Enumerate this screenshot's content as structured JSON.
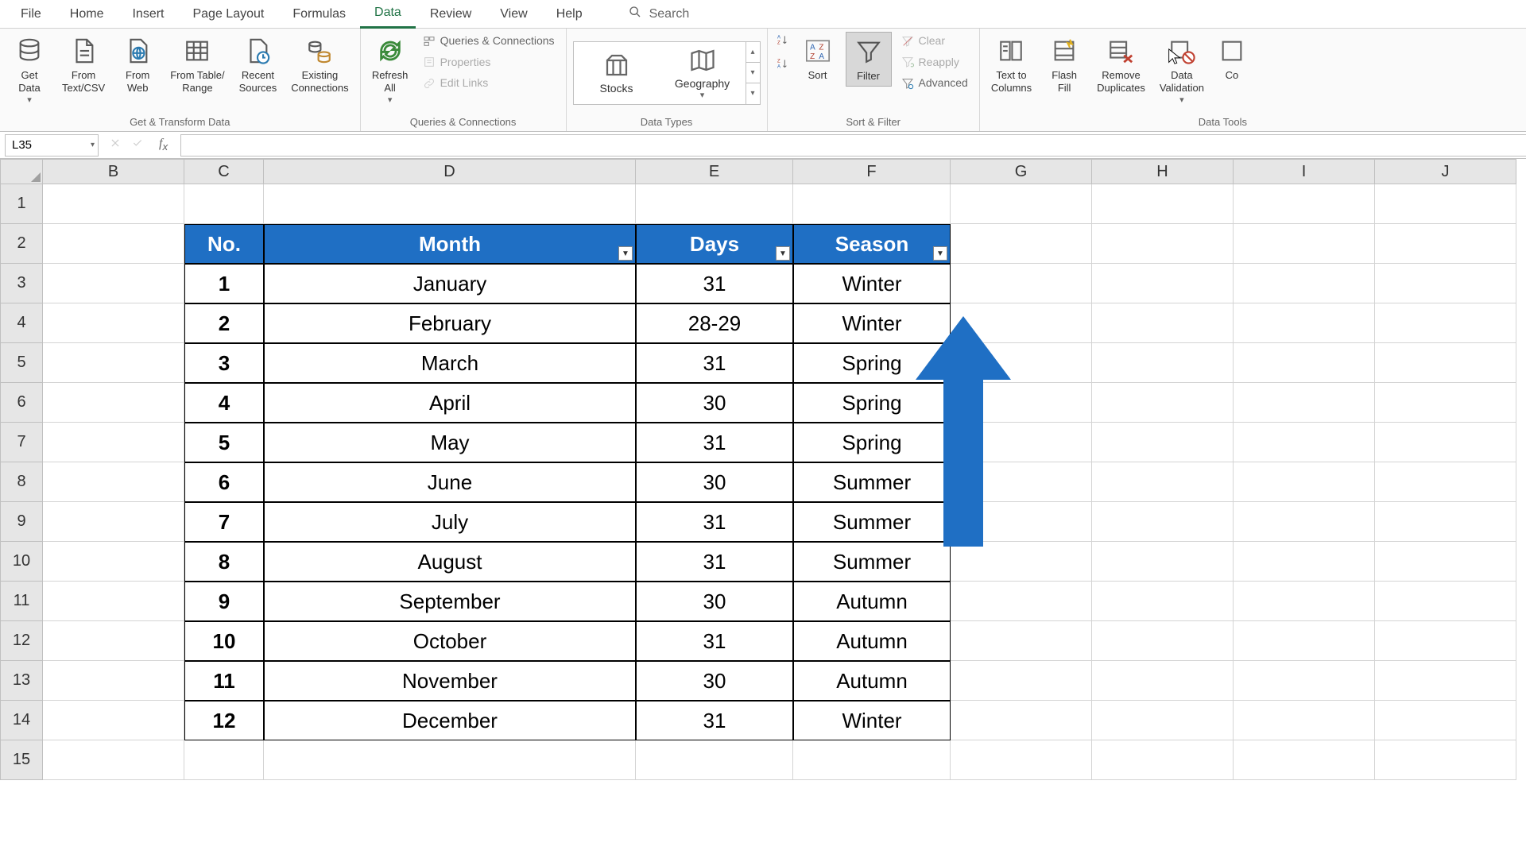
{
  "tabs": [
    "File",
    "Home",
    "Insert",
    "Page Layout",
    "Formulas",
    "Data",
    "Review",
    "View",
    "Help"
  ],
  "active_tab": "Data",
  "search_placeholder": "Search",
  "ribbon": {
    "group1": {
      "label": "Get & Transform Data",
      "btns": [
        "Get\nData",
        "From\nText/CSV",
        "From\nWeb",
        "From Table/\nRange",
        "Recent\nSources",
        "Existing\nConnections"
      ]
    },
    "group2": {
      "label": "Queries & Connections",
      "main": "Refresh\nAll",
      "items": [
        "Queries & Connections",
        "Properties",
        "Edit Links"
      ]
    },
    "group3": {
      "label": "Data Types",
      "items": [
        "Stocks",
        "Geography"
      ]
    },
    "group4": {
      "label": "Sort & Filter",
      "sort": "Sort",
      "filter": "Filter",
      "clear": "Clear",
      "reapply": "Reapply",
      "advanced": "Advanced"
    },
    "group5": {
      "label": "Data Tools",
      "btns": [
        "Text to\nColumns",
        "Flash\nFill",
        "Remove\nDuplicates",
        "Data\nValidation",
        "Co"
      ]
    }
  },
  "namebox": "L35",
  "formula": "",
  "columns": [
    "B",
    "C",
    "D",
    "E",
    "F",
    "G",
    "H",
    "I",
    "J"
  ],
  "row_count": 15,
  "table": {
    "headers": [
      "No.",
      "Month",
      "Days",
      "Season"
    ],
    "rows": [
      [
        "1",
        "January",
        "31",
        "Winter"
      ],
      [
        "2",
        "February",
        "28-29",
        "Winter"
      ],
      [
        "3",
        "March",
        "31",
        "Spring"
      ],
      [
        "4",
        "April",
        "30",
        "Spring"
      ],
      [
        "5",
        "May",
        "31",
        "Spring"
      ],
      [
        "6",
        "June",
        "30",
        "Summer"
      ],
      [
        "7",
        "July",
        "31",
        "Summer"
      ],
      [
        "8",
        "August",
        "31",
        "Summer"
      ],
      [
        "9",
        "September",
        "30",
        "Autumn"
      ],
      [
        "10",
        "October",
        "31",
        "Autumn"
      ],
      [
        "11",
        "November",
        "30",
        "Autumn"
      ],
      [
        "12",
        "December",
        "31",
        "Winter"
      ]
    ]
  }
}
